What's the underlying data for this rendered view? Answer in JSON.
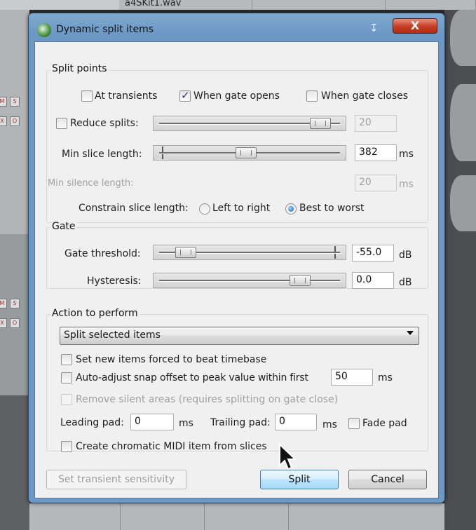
{
  "background": {
    "file_name": "a4SKit1.wav",
    "mini_buttons": [
      "M",
      "S",
      "X",
      "O"
    ]
  },
  "window": {
    "title": "Dynamic split items",
    "close_label": "X",
    "pin_glyph": "↧"
  },
  "split_points": {
    "group_title": "Split points",
    "at_transients": {
      "label": "At transients",
      "checked": false
    },
    "when_gate_opens": {
      "label": "When gate opens",
      "checked": true
    },
    "when_gate_closes": {
      "label": "When gate closes",
      "checked": false
    },
    "reduce_splits": {
      "label": "Reduce splits:",
      "checked": false,
      "value": "20",
      "slider_fraction": 0.92
    },
    "min_slice_length": {
      "label": "Min slice length:",
      "value": "382",
      "unit": "ms",
      "slider_fraction": 0.48
    },
    "min_silence_length": {
      "label": "Min silence length:",
      "value": "20",
      "unit": "ms",
      "disabled": true
    },
    "constrain": {
      "label": "Constrain slice length:",
      "options": [
        {
          "label": "Left to right",
          "selected": false
        },
        {
          "label": "Best to worst",
          "selected": true
        }
      ]
    }
  },
  "gate": {
    "group_title": "Gate",
    "threshold": {
      "label": "Gate threshold:",
      "value": "-55.0",
      "unit": "dB",
      "slider_fraction": 0.12
    },
    "hysteresis": {
      "label": "Hysteresis:",
      "value": "0.0",
      "unit": "dB",
      "slider_fraction": 0.8
    }
  },
  "action": {
    "group_title": "Action to perform",
    "selected_action": "Split selected items",
    "set_new_items": {
      "label": "Set new items forced to beat timebase",
      "checked": false
    },
    "auto_adjust": {
      "label": "Auto-adjust snap offset to peak value within first",
      "checked": false,
      "value": "50",
      "unit": "ms"
    },
    "remove_silent": {
      "label": "Remove silent areas (requires splitting on gate close)",
      "checked": false,
      "disabled": true
    },
    "leading_pad": {
      "label": "Leading pad:",
      "value": "0",
      "unit": "ms"
    },
    "trailing_pad": {
      "label": "Trailing pad:",
      "value": "0",
      "unit": "ms"
    },
    "fade_pad": {
      "label": "Fade pad",
      "checked": false
    },
    "create_midi": {
      "label": "Create chromatic MIDI item from slices",
      "checked": false
    }
  },
  "buttons": {
    "transient_sensitivity": "Set transient sensitivity",
    "split": "Split",
    "cancel": "Cancel"
  },
  "colors": {
    "titlebar": "#6b98c4",
    "close": "#c53d21",
    "dialog_bg": "#f0f0f0",
    "primary_button": "#bee6fd"
  }
}
